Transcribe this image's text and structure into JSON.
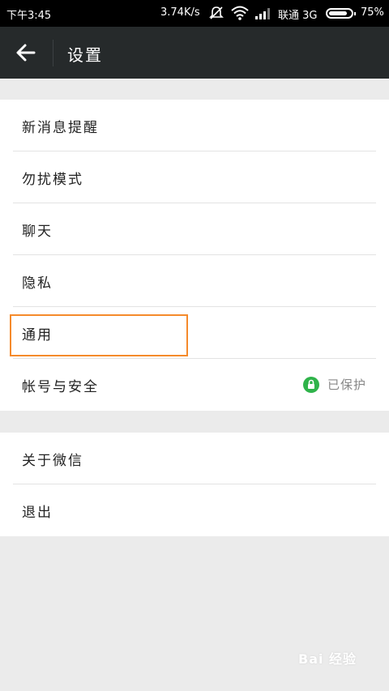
{
  "statusbar": {
    "time": "下午3:45",
    "speed": "3.74K/s",
    "carrier": "联通 3G",
    "battery": "75%"
  },
  "titlebar": {
    "title": "设置"
  },
  "groups": [
    {
      "items": [
        {
          "label": "新消息提醒"
        },
        {
          "label": "勿扰模式"
        },
        {
          "label": "聊天"
        },
        {
          "label": "隐私"
        },
        {
          "label": "通用"
        },
        {
          "label": "帐号与安全",
          "status": "已保护"
        }
      ]
    },
    {
      "items": [
        {
          "label": "关于微信"
        },
        {
          "label": "退出"
        }
      ]
    }
  ],
  "watermark": "Bai 经验",
  "colors": {
    "titlebar": "#262a2b",
    "highlight": "#f58a2b",
    "lock": "#2fb34a"
  }
}
